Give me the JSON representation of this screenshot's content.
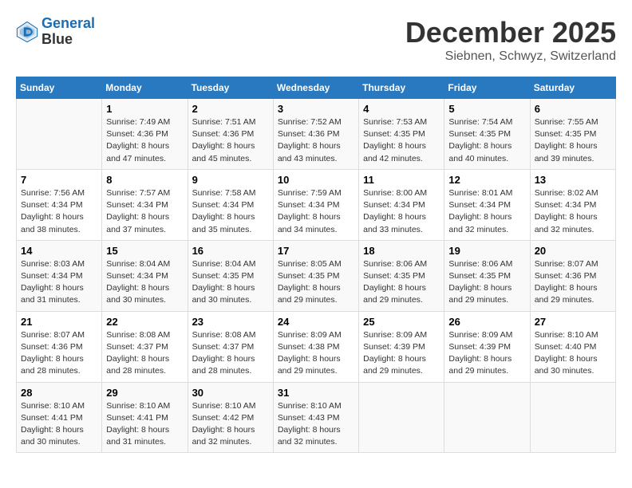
{
  "header": {
    "logo_line1": "General",
    "logo_line2": "Blue",
    "month": "December 2025",
    "location": "Siebnen, Schwyz, Switzerland"
  },
  "weekdays": [
    "Sunday",
    "Monday",
    "Tuesday",
    "Wednesday",
    "Thursday",
    "Friday",
    "Saturday"
  ],
  "weeks": [
    [
      {
        "day": "",
        "info": ""
      },
      {
        "day": "1",
        "info": "Sunrise: 7:49 AM\nSunset: 4:36 PM\nDaylight: 8 hours\nand 47 minutes."
      },
      {
        "day": "2",
        "info": "Sunrise: 7:51 AM\nSunset: 4:36 PM\nDaylight: 8 hours\nand 45 minutes."
      },
      {
        "day": "3",
        "info": "Sunrise: 7:52 AM\nSunset: 4:36 PM\nDaylight: 8 hours\nand 43 minutes."
      },
      {
        "day": "4",
        "info": "Sunrise: 7:53 AM\nSunset: 4:35 PM\nDaylight: 8 hours\nand 42 minutes."
      },
      {
        "day": "5",
        "info": "Sunrise: 7:54 AM\nSunset: 4:35 PM\nDaylight: 8 hours\nand 40 minutes."
      },
      {
        "day": "6",
        "info": "Sunrise: 7:55 AM\nSunset: 4:35 PM\nDaylight: 8 hours\nand 39 minutes."
      }
    ],
    [
      {
        "day": "7",
        "info": "Sunrise: 7:56 AM\nSunset: 4:34 PM\nDaylight: 8 hours\nand 38 minutes."
      },
      {
        "day": "8",
        "info": "Sunrise: 7:57 AM\nSunset: 4:34 PM\nDaylight: 8 hours\nand 37 minutes."
      },
      {
        "day": "9",
        "info": "Sunrise: 7:58 AM\nSunset: 4:34 PM\nDaylight: 8 hours\nand 35 minutes."
      },
      {
        "day": "10",
        "info": "Sunrise: 7:59 AM\nSunset: 4:34 PM\nDaylight: 8 hours\nand 34 minutes."
      },
      {
        "day": "11",
        "info": "Sunrise: 8:00 AM\nSunset: 4:34 PM\nDaylight: 8 hours\nand 33 minutes."
      },
      {
        "day": "12",
        "info": "Sunrise: 8:01 AM\nSunset: 4:34 PM\nDaylight: 8 hours\nand 32 minutes."
      },
      {
        "day": "13",
        "info": "Sunrise: 8:02 AM\nSunset: 4:34 PM\nDaylight: 8 hours\nand 32 minutes."
      }
    ],
    [
      {
        "day": "14",
        "info": "Sunrise: 8:03 AM\nSunset: 4:34 PM\nDaylight: 8 hours\nand 31 minutes."
      },
      {
        "day": "15",
        "info": "Sunrise: 8:04 AM\nSunset: 4:34 PM\nDaylight: 8 hours\nand 30 minutes."
      },
      {
        "day": "16",
        "info": "Sunrise: 8:04 AM\nSunset: 4:35 PM\nDaylight: 8 hours\nand 30 minutes."
      },
      {
        "day": "17",
        "info": "Sunrise: 8:05 AM\nSunset: 4:35 PM\nDaylight: 8 hours\nand 29 minutes."
      },
      {
        "day": "18",
        "info": "Sunrise: 8:06 AM\nSunset: 4:35 PM\nDaylight: 8 hours\nand 29 minutes."
      },
      {
        "day": "19",
        "info": "Sunrise: 8:06 AM\nSunset: 4:35 PM\nDaylight: 8 hours\nand 29 minutes."
      },
      {
        "day": "20",
        "info": "Sunrise: 8:07 AM\nSunset: 4:36 PM\nDaylight: 8 hours\nand 29 minutes."
      }
    ],
    [
      {
        "day": "21",
        "info": "Sunrise: 8:07 AM\nSunset: 4:36 PM\nDaylight: 8 hours\nand 28 minutes."
      },
      {
        "day": "22",
        "info": "Sunrise: 8:08 AM\nSunset: 4:37 PM\nDaylight: 8 hours\nand 28 minutes."
      },
      {
        "day": "23",
        "info": "Sunrise: 8:08 AM\nSunset: 4:37 PM\nDaylight: 8 hours\nand 28 minutes."
      },
      {
        "day": "24",
        "info": "Sunrise: 8:09 AM\nSunset: 4:38 PM\nDaylight: 8 hours\nand 29 minutes."
      },
      {
        "day": "25",
        "info": "Sunrise: 8:09 AM\nSunset: 4:39 PM\nDaylight: 8 hours\nand 29 minutes."
      },
      {
        "day": "26",
        "info": "Sunrise: 8:09 AM\nSunset: 4:39 PM\nDaylight: 8 hours\nand 29 minutes."
      },
      {
        "day": "27",
        "info": "Sunrise: 8:10 AM\nSunset: 4:40 PM\nDaylight: 8 hours\nand 30 minutes."
      }
    ],
    [
      {
        "day": "28",
        "info": "Sunrise: 8:10 AM\nSunset: 4:41 PM\nDaylight: 8 hours\nand 30 minutes."
      },
      {
        "day": "29",
        "info": "Sunrise: 8:10 AM\nSunset: 4:41 PM\nDaylight: 8 hours\nand 31 minutes."
      },
      {
        "day": "30",
        "info": "Sunrise: 8:10 AM\nSunset: 4:42 PM\nDaylight: 8 hours\nand 32 minutes."
      },
      {
        "day": "31",
        "info": "Sunrise: 8:10 AM\nSunset: 4:43 PM\nDaylight: 8 hours\nand 32 minutes."
      },
      {
        "day": "",
        "info": ""
      },
      {
        "day": "",
        "info": ""
      },
      {
        "day": "",
        "info": ""
      }
    ]
  ]
}
